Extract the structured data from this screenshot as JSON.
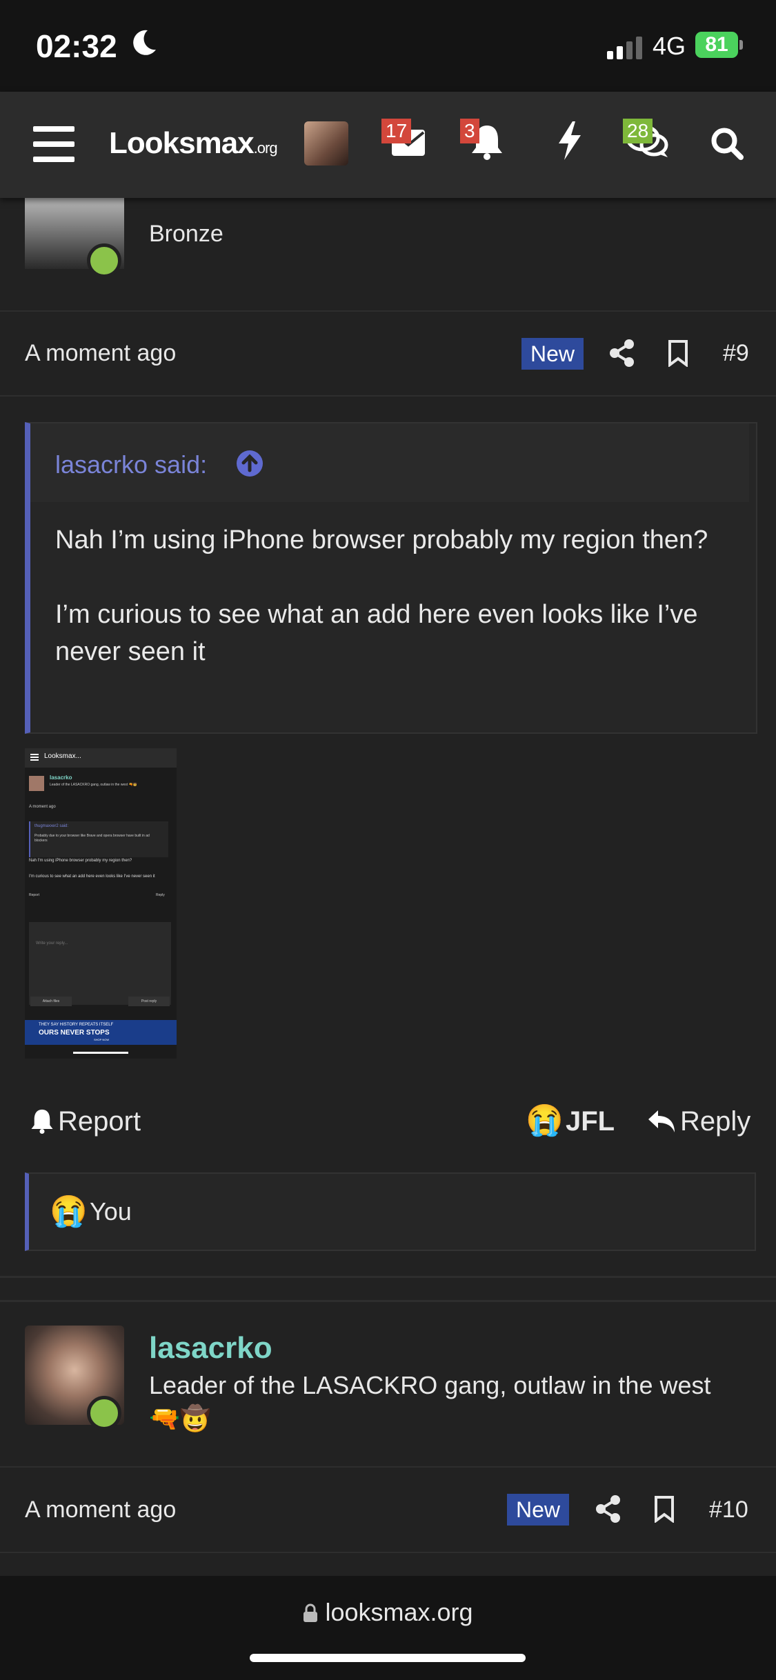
{
  "status_bar": {
    "time": "02:32",
    "network": "4G",
    "battery": "81"
  },
  "nav": {
    "logo": "Looksmax",
    "logo_suffix": ".org",
    "badges": {
      "messages": "17",
      "alerts": "3",
      "chats": "28"
    }
  },
  "post_top": {
    "user_title": "Bronze"
  },
  "post9": {
    "time": "A moment ago",
    "new_label": "New",
    "number": "#9",
    "quote_author": "lasacrko said:",
    "quote_paragraphs": [
      "Nah I’m using iPhone browser probably my region then?",
      "I’m curious to see what an add here even looks like I’ve never seen it"
    ],
    "thumb": {
      "logo": "Looksmax...",
      "user": "lasacrko",
      "user_title": "Leader of the LASACKRO gang, outlaw in the west 🔫🤠",
      "time": "A moment ago",
      "quote_author": "thugmaxxer2 said:",
      "quote_text": "Probably due to your browser like Brave and opera browser have built in ad blockers",
      "body1": "Nah I'm using iPhone browser probably my region then?",
      "body2": "I'm curious to see what an add here even looks like I've never seen it",
      "report": "Report",
      "reply": "Reply",
      "editor_placeholder": "Write your reply...",
      "attach": "Attach files",
      "post_reply": "Post reply",
      "ad_line1": "THEY SAY HISTORY REPEATS ITSELF",
      "ad_line2": "OURS NEVER STOPS",
      "ad_cta": "SHOP NOW"
    },
    "actions": {
      "report": "Report",
      "reaction": "JFL",
      "reply": "Reply"
    },
    "reactions": {
      "emoji": "😭",
      "users": "You"
    }
  },
  "post10": {
    "username": "lasacrko",
    "user_title": "Leader of the LASACKRO gang, outlaw in the west",
    "user_title_emoji": "🔫🤠",
    "time": "A moment ago",
    "new_label": "New",
    "number": "#10"
  },
  "browser": {
    "url": "looksmax.org"
  }
}
